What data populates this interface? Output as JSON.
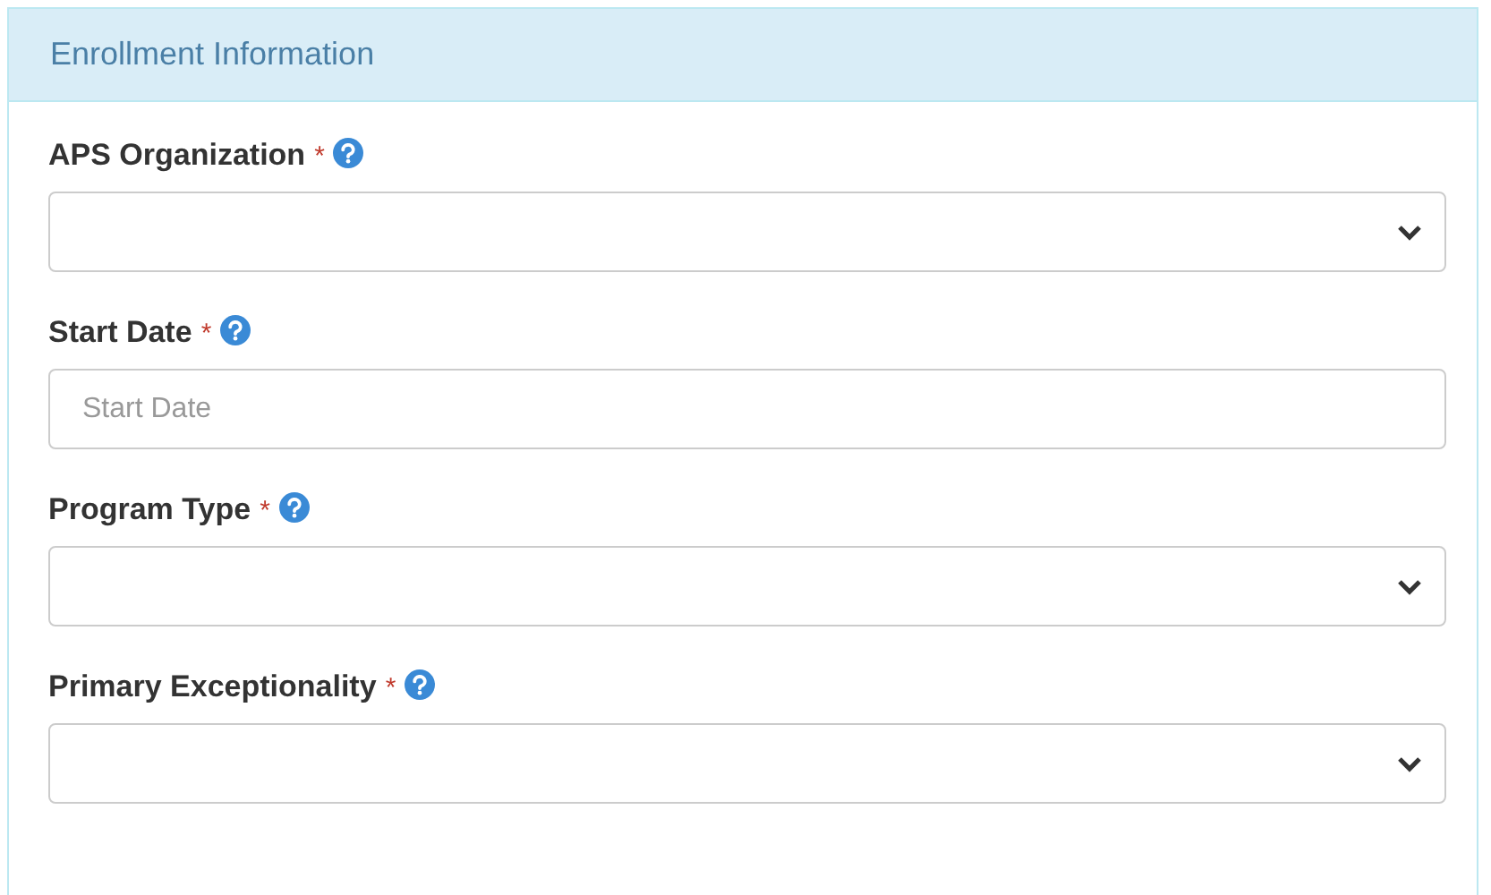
{
  "panel": {
    "title": "Enrollment Information"
  },
  "fields": [
    {
      "kind": "select",
      "label": "APS Organization",
      "required_mark": "*"
    },
    {
      "kind": "text",
      "label": "Start Date",
      "required_mark": "*",
      "placeholder": "Start Date"
    },
    {
      "kind": "select",
      "label": "Program Type",
      "required_mark": "*"
    },
    {
      "kind": "select",
      "label": "Primary Exceptionality",
      "required_mark": "*"
    }
  ]
}
